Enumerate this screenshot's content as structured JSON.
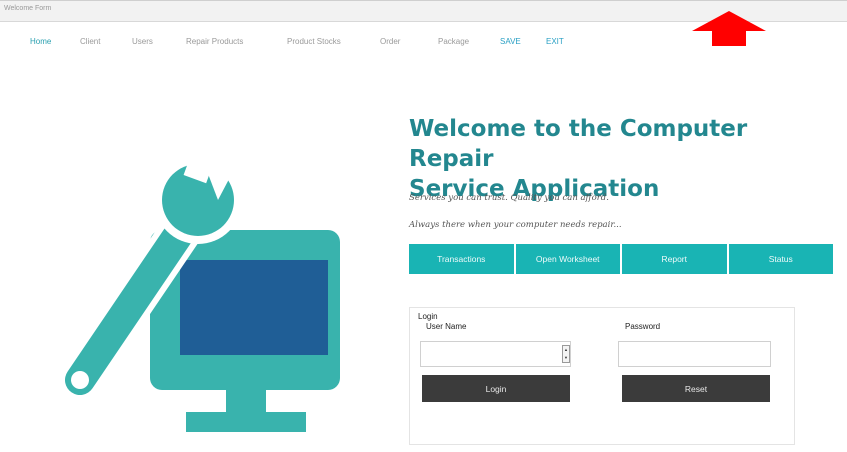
{
  "window": {
    "title": "Welcome Form"
  },
  "nav": {
    "items": [
      {
        "label": "Home"
      },
      {
        "label": "Client"
      },
      {
        "label": "Users"
      },
      {
        "label": "Repair Products"
      },
      {
        "label": "Product Stocks"
      },
      {
        "label": "Order"
      },
      {
        "label": "Package"
      },
      {
        "label": "SAVE"
      },
      {
        "label": "EXIT"
      }
    ]
  },
  "hero": {
    "heading_line1": "Welcome to the Computer Repair",
    "heading_line2": "Service Application",
    "tagline1": "Services you can trust. Quality you can afford.",
    "tagline2": "Always there when your computer needs repair..."
  },
  "tabs": [
    {
      "label": "Transactions"
    },
    {
      "label": "Open Worksheet"
    },
    {
      "label": "Report"
    },
    {
      "label": "Status"
    }
  ],
  "login": {
    "legend": "Login",
    "username_label": "User Name",
    "password_label": "Password",
    "username_value": "",
    "password_value": "",
    "login_button": "Login",
    "reset_button": "Reset"
  },
  "colors": {
    "teal_accent": "#19b4b4",
    "heading_teal": "#23878f",
    "monitor_blue": "#1f5e96",
    "art_teal": "#39b3ad",
    "button_dark": "#3b3b3b",
    "arrow_red": "#ff0000"
  },
  "icons": {
    "art": "wrench-monitor-icon",
    "arrow": "red-arrow-up-icon"
  }
}
